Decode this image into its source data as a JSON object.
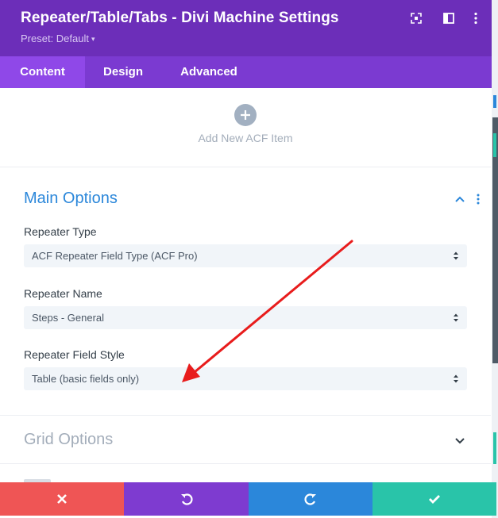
{
  "header": {
    "title": "Repeater/Table/Tabs - Divi Machine Settings",
    "preset_label": "Preset: Default",
    "icons": [
      "expand-icon",
      "sidebar-toggle-icon",
      "more-vertical-icon"
    ]
  },
  "tabs": [
    {
      "label": "Content",
      "active": true
    },
    {
      "label": "Design",
      "active": false
    },
    {
      "label": "Advanced",
      "active": false
    }
  ],
  "add_item": {
    "label": "Add New ACF Item",
    "icon": "plus-icon"
  },
  "main_options": {
    "title": "Main Options",
    "fields": [
      {
        "label": "Repeater Type",
        "value": "ACF Repeater Field Type (ACF Pro)"
      },
      {
        "label": "Repeater Name",
        "value": "Steps - General"
      },
      {
        "label": "Repeater Field Style",
        "value": "Table (basic fields only)"
      }
    ]
  },
  "grid_options": {
    "title": "Grid Options"
  },
  "footer": {
    "buttons": [
      {
        "name": "discard",
        "icon": "close-icon",
        "color": "#ef5555"
      },
      {
        "name": "undo",
        "icon": "undo-icon",
        "color": "#7e3bd0"
      },
      {
        "name": "redo",
        "icon": "redo-icon",
        "color": "#2b87da"
      },
      {
        "name": "save",
        "icon": "check-icon",
        "color": "#29c4a9"
      }
    ]
  },
  "colors": {
    "header_bg": "#6c2eb9",
    "tabs_bg": "#7b3ad1",
    "active_tab_bg": "#8f48e8",
    "section_title_active": "#2b87da",
    "section_title_muted": "#a3adba",
    "annotation_arrow": "#e81c1c"
  }
}
